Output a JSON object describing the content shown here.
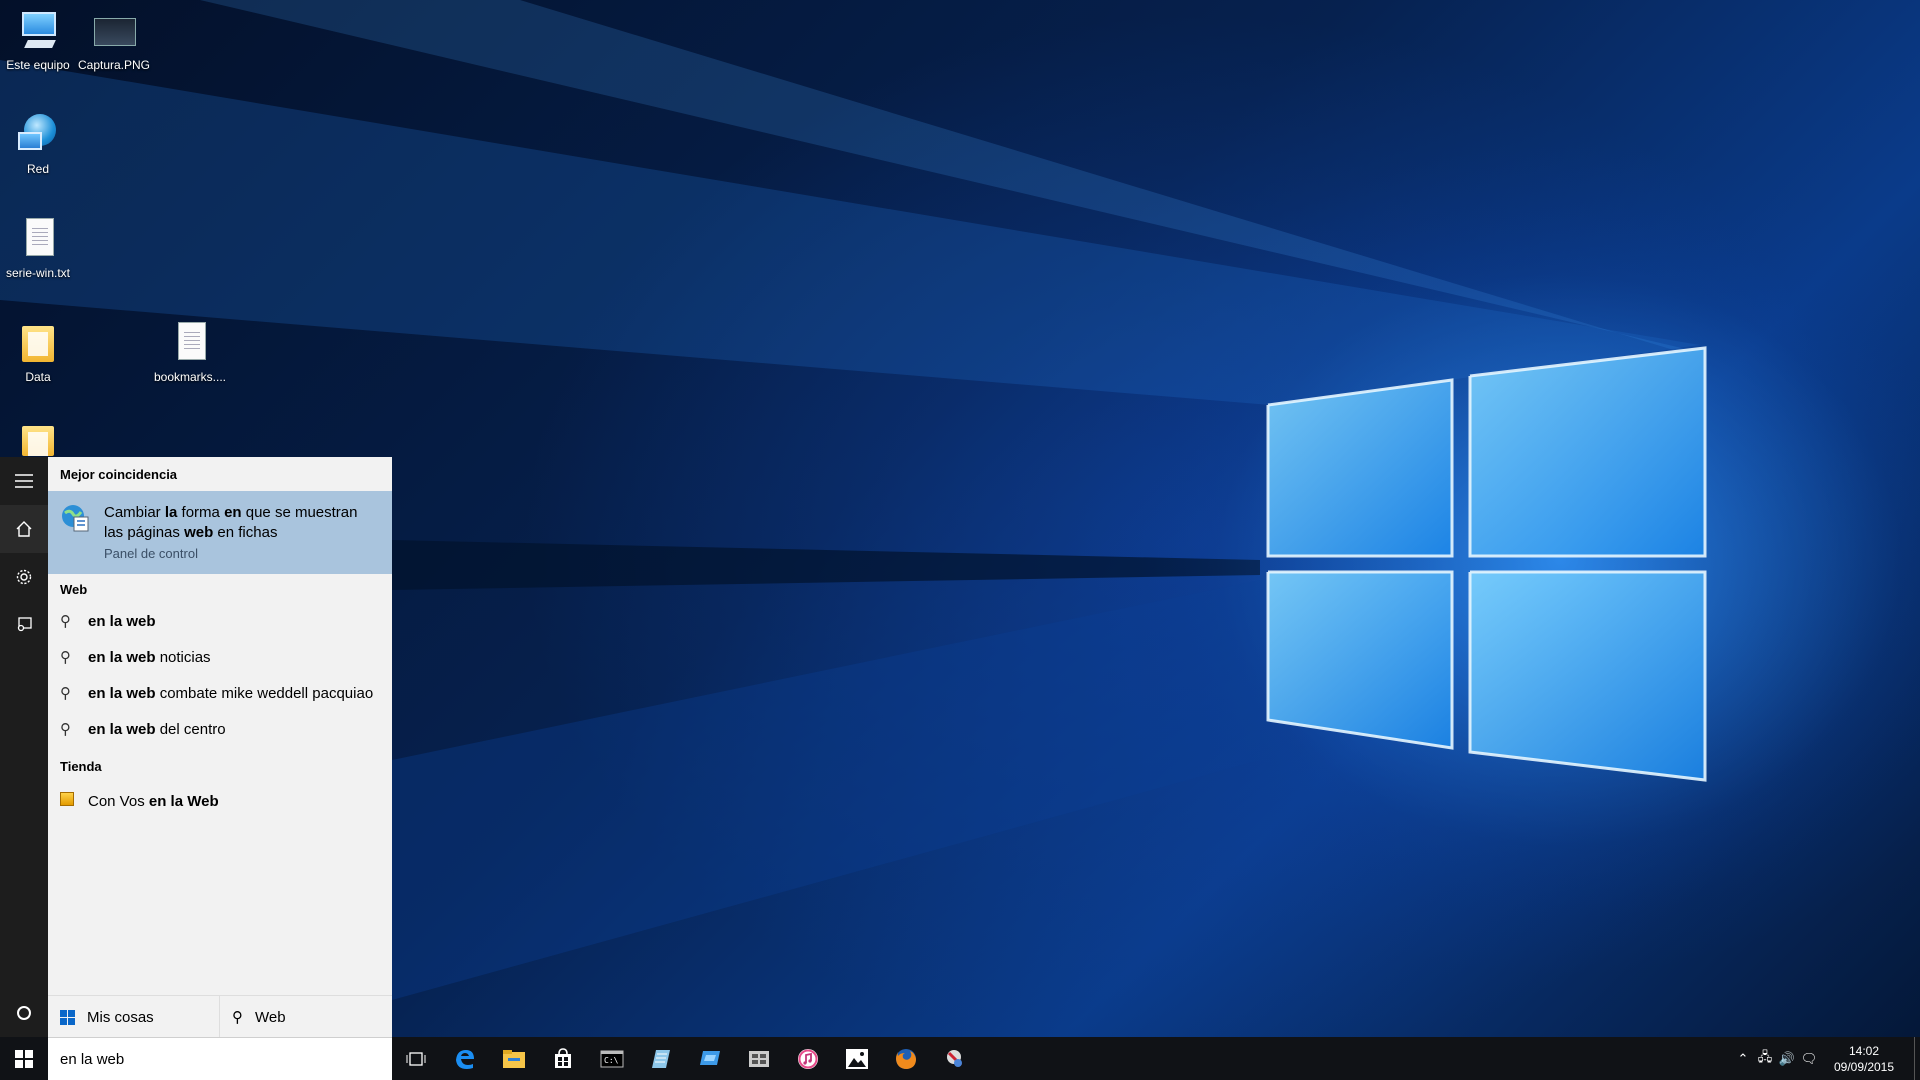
{
  "desktop": {
    "icons": [
      {
        "label": "Este equipo",
        "icon": "computer-icon"
      },
      {
        "label": "Captura.PNG",
        "icon": "image-file-icon"
      },
      {
        "label": "Red",
        "icon": "network-icon"
      },
      {
        "label": "serie-win.txt",
        "icon": "text-file-icon"
      },
      {
        "label": "Data",
        "icon": "folder-icon"
      },
      {
        "label": "bookmarks....",
        "icon": "text-file-icon"
      },
      {
        "label": "",
        "icon": "folder-icon"
      }
    ]
  },
  "search_panel": {
    "best_match_header": "Mejor coincidencia",
    "best_match": {
      "title_parts": [
        {
          "t": "Cambiar ",
          "b": false
        },
        {
          "t": "la",
          "b": true
        },
        {
          "t": " forma ",
          "b": false
        },
        {
          "t": "en",
          "b": true
        },
        {
          "t": " que se muestran las páginas ",
          "b": false
        },
        {
          "t": "web",
          "b": true
        },
        {
          "t": " en fichas",
          "b": false
        }
      ],
      "subtitle": "Panel de control",
      "icon": "control-panel-globe-icon"
    },
    "web_header": "Web",
    "web_results": [
      {
        "bold": "en la web",
        "rest": ""
      },
      {
        "bold": "en la web",
        "rest": " noticias"
      },
      {
        "bold": "en la web",
        "rest": " combate mike weddell pacquiao"
      },
      {
        "bold": "en la web",
        "rest": " del centro"
      }
    ],
    "store_header": "Tienda",
    "store_results": [
      {
        "pre": "Con Vos ",
        "bold": "en la Web",
        "icon": "store-app-icon"
      }
    ],
    "tabs": {
      "my_stuff": "Mis cosas",
      "web": "Web"
    }
  },
  "search_box": {
    "value": "en la web"
  },
  "rail": {
    "items": [
      "menu-icon",
      "home-icon",
      "settings-icon",
      "feedback-icon",
      "cortana-icon"
    ]
  },
  "taskbar": {
    "apps": [
      "task-view-icon",
      "edge-icon",
      "file-explorer-icon",
      "store-icon",
      "cmd-icon",
      "notepad-icon",
      "remote-desktop-icon",
      "filmstrip-icon",
      "itunes-icon",
      "photos-icon",
      "firefox-icon",
      "tools-icon"
    ],
    "clock": {
      "time": "14:02",
      "date": "09/09/2015"
    }
  },
  "colors": {
    "accent": "#0a67c9",
    "best_match_bg": "#a9c4dd",
    "panel_bg": "#f2f2f2",
    "taskbar_bg": "#101216"
  }
}
